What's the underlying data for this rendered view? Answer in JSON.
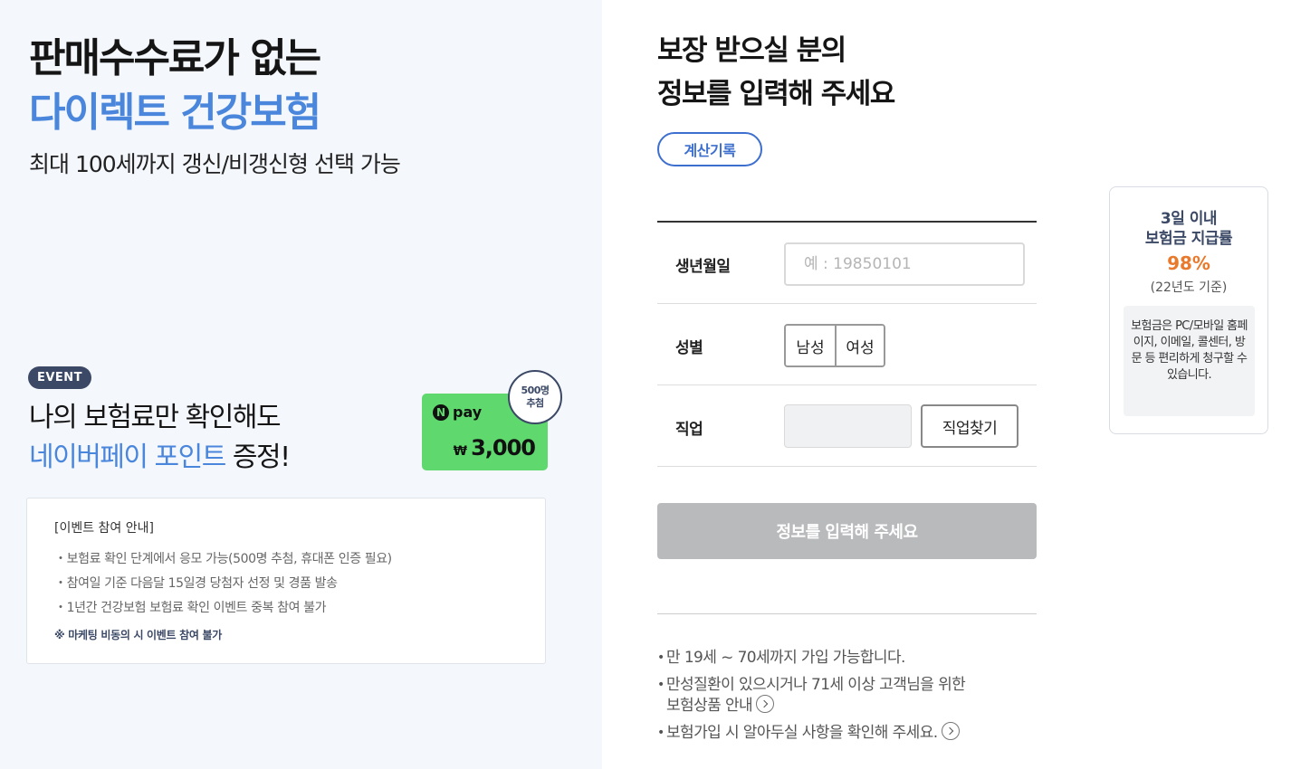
{
  "hero": {
    "title_line1": "판매수수료가 없는",
    "title_line2": "다이렉트 건강보험",
    "subtitle": "최대 100세까지 갱신/비갱신형 선택 가능"
  },
  "event": {
    "badge": "EVENT",
    "title_line1": "나의 보험료만 확인해도",
    "title_line2_highlight": "네이버페이 포인트",
    "title_line2_rest": " 증정!",
    "npay_logo_n": "N",
    "npay_logo_text": "pay",
    "npay_currency": "₩",
    "npay_amount": "3,000",
    "draw_count": "500명",
    "draw_label": "추첨"
  },
  "notice": {
    "title": "[이벤트 참여 안내]",
    "items": [
      "보험료 확인 단계에서 응모 가능(500명 추첨, 휴대폰 인증 필요)",
      "참여일 기준 다음달 15일경 당첨자 선정 및 경품 발송",
      "1년간 건강보험 보험료 확인 이벤트 중복 참여 불가"
    ],
    "warning": "※ 마케팅 비동의 시 이벤트 참여 불가"
  },
  "form": {
    "title_line1": "보장 받으실 분의",
    "title_line2": "정보를 입력해 주세요",
    "history_button": "계산기록",
    "birth": {
      "label": "생년월일",
      "placeholder": "예 : 19850101",
      "value": ""
    },
    "gender": {
      "label": "성별",
      "male": "남성",
      "female": "여성"
    },
    "job": {
      "label": "직업",
      "value": "",
      "search_button": "직업찾기"
    },
    "submit_button": "정보를 입력해 주세요"
  },
  "info": {
    "items": [
      "만 19세 ~ 70세까지 가입 가능합니다.",
      "만성질환이 있으시거나 71세 이상 고객님을 위한",
      "보험가입 시 알아두실 사항을 확인해 주세요."
    ],
    "item2_line2": "보험상품 안내"
  },
  "side_card": {
    "line1": "3일 이내",
    "line2": "보험금 지급률",
    "rate": "98%",
    "basis": "(22년도 기준)",
    "note": "보험금은 PC/모바일 홈페이지, 이메일, 콜센터, 방문 등 편리하게 청구할 수 있습니다."
  },
  "colors": {
    "accent_blue": "#4a86db",
    "navy": "#3b4966",
    "npay_green": "#5fd96d",
    "rate_orange": "#e9792c",
    "disabled_gray": "#b9babc"
  }
}
